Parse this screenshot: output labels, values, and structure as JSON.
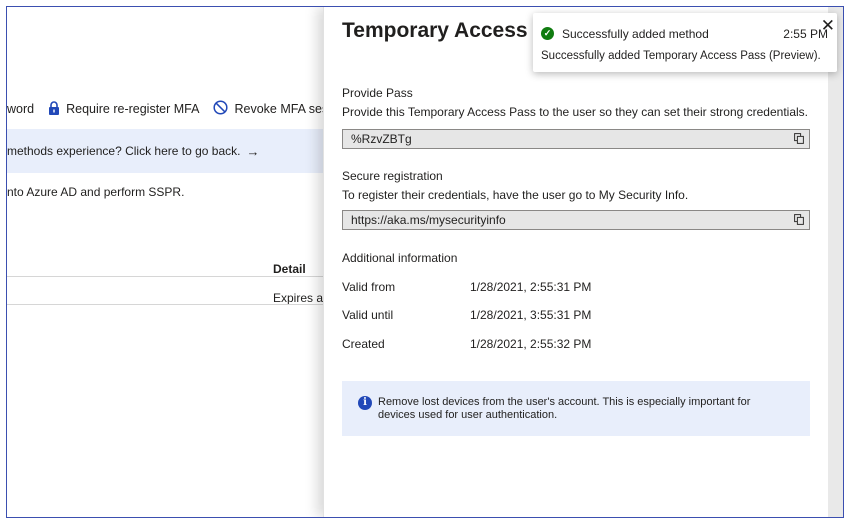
{
  "background_page": {
    "toolbar": [
      {
        "label": "word",
        "icon": "none"
      },
      {
        "label": "Require re-register MFA",
        "icon": "lock-icon"
      },
      {
        "label": "Revoke MFA session",
        "icon": "blocked-icon"
      }
    ],
    "banner_text": "methods experience? Click here to go back.",
    "banner_arrow": "→",
    "body_text": "nto Azure AD and perform SSPR.",
    "table_header": "Detail",
    "table_cell": "Expires at"
  },
  "panel": {
    "title": "Temporary Access Pass",
    "provide_pass": {
      "heading": "Provide Pass",
      "description": "Provide this Temporary Access Pass to the user so they can set their strong credentials.",
      "value": "%RzvZBTg"
    },
    "secure_registration": {
      "heading": "Secure registration",
      "description": "To register their credentials, have the user go to My Security Info.",
      "value": "https://aka.ms/mysecurityinfo"
    },
    "additional": {
      "heading": "Additional information",
      "rows": [
        {
          "label": "Valid from",
          "value": "1/28/2021, 2:55:31 PM"
        },
        {
          "label": "Valid until",
          "value": "1/28/2021, 3:55:31 PM"
        },
        {
          "label": "Created",
          "value": "1/28/2021, 2:55:32 PM"
        }
      ]
    },
    "info_message": "Remove lost devices from the user's account. This is especially important for devices used for user authentication.",
    "info_icon_glyph": "i"
  },
  "toast": {
    "title": "Successfully added method",
    "time": "2:55 PM",
    "message": "Successfully added Temporary Access Pass (Preview).",
    "close_glyph": "✕",
    "check_glyph": "✓"
  },
  "colors": {
    "accent": "#2148b8",
    "success": "#107c10",
    "banner": "#e8eefb"
  }
}
